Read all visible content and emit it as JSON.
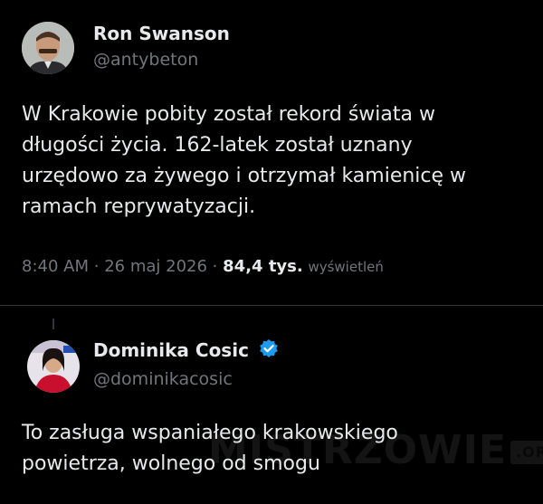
{
  "tweet": {
    "author_name": "Ron Swanson",
    "author_handle": "@antybeton",
    "text_lines": [
      "W Krakowie pobity został rekord świata w",
      "długości życia. 162-latek został uznany",
      "urzędowo za żywego i otrzymał kamienicę w",
      "ramach reprywatyzacji."
    ],
    "time": "8:40 AM",
    "separator": "·",
    "date": "26 maj 2026",
    "views_count": "84,4 tys.",
    "views_label": "wyświetleń"
  },
  "reply": {
    "author_name": "Dominika Cosic",
    "author_handle": "@dominikacosic",
    "text_lines": [
      "To zasługa wspaniałego krakowskiego",
      "powietrza, wolnego od smogu"
    ]
  },
  "watermark": {
    "text": "MISTRZOWIE",
    "suffix": ".ORG"
  },
  "colors": {
    "background": "#000000",
    "primary_text": "#e7e9ea",
    "secondary_text": "#71767b",
    "verified_badge": "#1d9bf0"
  }
}
